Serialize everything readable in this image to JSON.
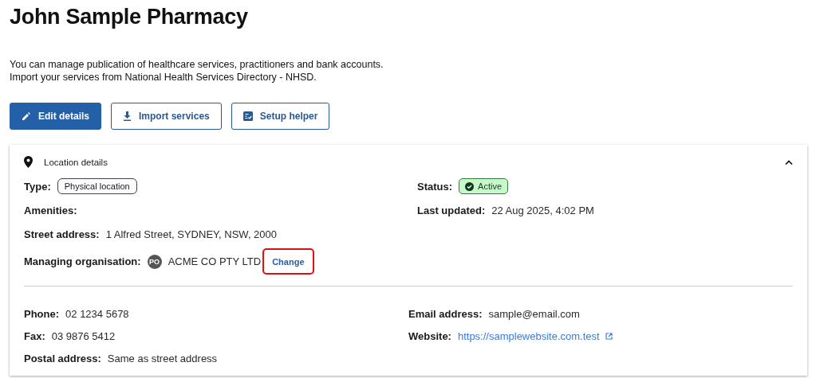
{
  "page": {
    "title": "John Sample Pharmacy",
    "intro": [
      "You can manage publication of healthcare services, practitioners and bank accounts.",
      "Import your services from National Health Services Directory - NHSD."
    ]
  },
  "buttons": [
    {
      "label": "Edit details",
      "kind": "primary"
    },
    {
      "label": "Import services",
      "kind": "outline"
    },
    {
      "label": "Setup helper",
      "kind": "outline"
    }
  ],
  "location_card": {
    "title": "Location details",
    "expanded": true,
    "left": [
      {
        "label": "Type:",
        "kind": "chip",
        "value": "Physical location"
      },
      {
        "label": "Amenities:",
        "kind": "empty"
      },
      {
        "label": "Street address:",
        "kind": "text",
        "value": "1 Alfred Street, SYDNEY, NSW, 2000"
      },
      {
        "label": "Managing organisation:",
        "kind": "org",
        "avatar": "PO",
        "value": "ACME CO PTY LTD",
        "action": "Change",
        "highlighted": true
      }
    ],
    "right": [
      {
        "label": "Status:",
        "kind": "status",
        "value": "Active"
      },
      {
        "label": "Last updated:",
        "kind": "text",
        "value": "22 Aug 2025, 4:02 PM"
      }
    ],
    "contact_left": [
      {
        "label": "Phone:",
        "kind": "text",
        "value": "02 1234 5678"
      },
      {
        "label": "Fax:",
        "kind": "text",
        "value": "03 9876 5412"
      },
      {
        "label": "Postal address:",
        "kind": "text",
        "value": "Same as street address"
      }
    ],
    "contact_right": [
      {
        "label": "Email address:",
        "kind": "text",
        "value": "sample@email.com"
      },
      {
        "label": "Website:",
        "kind": "link",
        "value": "https://samplewebsite.com.test"
      }
    ]
  }
}
